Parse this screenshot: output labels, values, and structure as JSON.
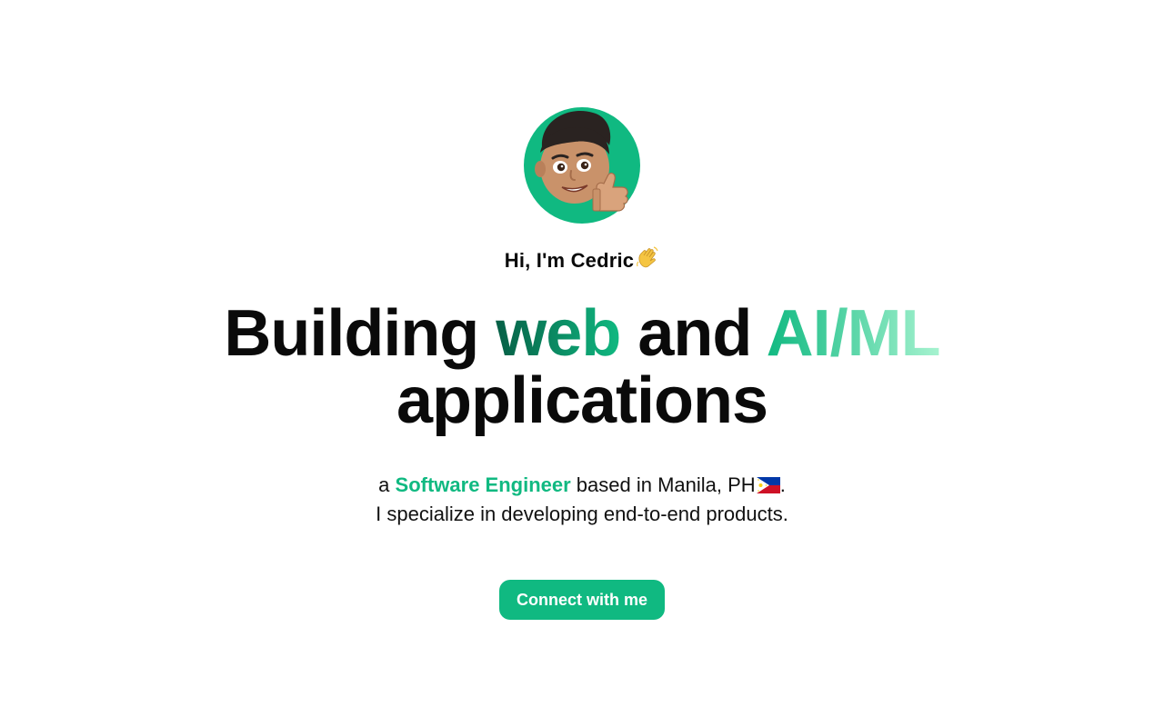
{
  "hero": {
    "greeting": "Hi, I'm Cedric",
    "greeting_emoji": "👋",
    "headline_part1": "Building ",
    "headline_highlight1": "web",
    "headline_part2": " and ",
    "headline_highlight2": "AI/ML",
    "headline_line2": "applications",
    "subtitle_prefix": "a ",
    "subtitle_role": "Software Engineer",
    "subtitle_location": " based in Manila, PH",
    "subtitle_suffix": ".",
    "subtitle_line2": "I specialize in developing end-to-end products.",
    "cta_label": "Connect with me"
  },
  "colors": {
    "accent": "#10b981",
    "accent_dark": "#065f46",
    "accent_light": "#a7f3d0",
    "text": "#0a0a0a",
    "background": "#ffffff"
  },
  "icons": {
    "avatar": "memoji-thumbs-up-avatar",
    "wave": "waving-hand-icon",
    "flag": "philippines-flag-icon"
  }
}
